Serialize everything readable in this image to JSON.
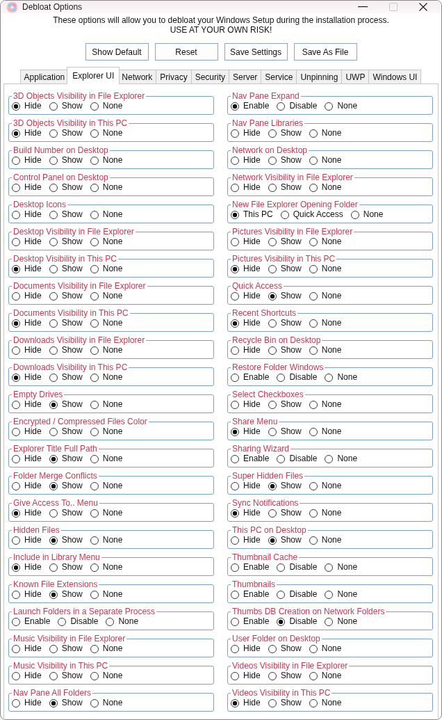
{
  "window": {
    "title": "Debloat Options",
    "maximize_disabled": true
  },
  "intro": "These options will allow you to debloat your Windows Setup during the installation process.",
  "warning": "USE AT YOUR OWN RISK!",
  "buttons": [
    "Show Default",
    "Reset",
    "Save Settings",
    "Save As File"
  ],
  "tabs": [
    {
      "label": "Application",
      "selected": false
    },
    {
      "label": "Explorer UI",
      "selected": true
    },
    {
      "label": "Network",
      "selected": false
    },
    {
      "label": "Privacy",
      "selected": false
    },
    {
      "label": "Security",
      "selected": false
    },
    {
      "label": "Server",
      "selected": false
    },
    {
      "label": "Service",
      "selected": false
    },
    {
      "label": "Unpinning",
      "selected": false
    },
    {
      "label": "UWP",
      "selected": false
    },
    {
      "label": "Windows UI",
      "selected": false
    }
  ],
  "columns": [
    {
      "groups": [
        {
          "title": "3D Objects Visibility in File Explorer",
          "choices": [
            {
              "label": "Hide",
              "selected": true
            },
            {
              "label": "Show",
              "selected": false
            },
            {
              "label": "None",
              "selected": false
            }
          ]
        },
        {
          "title": "3D Objects Visibility in This PC",
          "choices": [
            {
              "label": "Hide",
              "selected": true
            },
            {
              "label": "Show",
              "selected": false
            },
            {
              "label": "None",
              "selected": false
            }
          ]
        },
        {
          "title": "Build Number on Desktop",
          "choices": [
            {
              "label": "Hide",
              "selected": false
            },
            {
              "label": "Show",
              "selected": false
            },
            {
              "label": "None",
              "selected": false
            }
          ]
        },
        {
          "title": "Control Panel on Desktop",
          "choices": [
            {
              "label": "Hide",
              "selected": false
            },
            {
              "label": "Show",
              "selected": false
            },
            {
              "label": "None",
              "selected": false
            }
          ]
        },
        {
          "title": "Desktop Icons",
          "choices": [
            {
              "label": "Hide",
              "selected": false
            },
            {
              "label": "Show",
              "selected": false
            },
            {
              "label": "None",
              "selected": false
            }
          ]
        },
        {
          "title": "Desktop Visibility in File Explorer",
          "choices": [
            {
              "label": "Hide",
              "selected": false
            },
            {
              "label": "Show",
              "selected": false
            },
            {
              "label": "None",
              "selected": false
            }
          ]
        },
        {
          "title": "Desktop Visibility in This PC",
          "choices": [
            {
              "label": "Hide",
              "selected": true
            },
            {
              "label": "Show",
              "selected": false
            },
            {
              "label": "None",
              "selected": false
            }
          ]
        },
        {
          "title": "Documents Visibility in File Explorer",
          "choices": [
            {
              "label": "Hide",
              "selected": false
            },
            {
              "label": "Show",
              "selected": false
            },
            {
              "label": "None",
              "selected": false
            }
          ]
        },
        {
          "title": "Documents Visibility in This PC",
          "choices": [
            {
              "label": "Hide",
              "selected": true
            },
            {
              "label": "Show",
              "selected": false
            },
            {
              "label": "None",
              "selected": false
            }
          ]
        },
        {
          "title": "Downloads Visibility in File Explorer",
          "choices": [
            {
              "label": "Hide",
              "selected": false
            },
            {
              "label": "Show",
              "selected": false
            },
            {
              "label": "None",
              "selected": false
            }
          ]
        },
        {
          "title": "Downloads Visibility in This PC",
          "choices": [
            {
              "label": "Hide",
              "selected": true
            },
            {
              "label": "Show",
              "selected": false
            },
            {
              "label": "None",
              "selected": false
            }
          ]
        },
        {
          "title": "Empty Drives",
          "choices": [
            {
              "label": "Hide",
              "selected": false
            },
            {
              "label": "Show",
              "selected": true
            },
            {
              "label": "None",
              "selected": false
            }
          ]
        },
        {
          "title": "Encrypted / Compressed Files Color",
          "choices": [
            {
              "label": "Hide",
              "selected": false
            },
            {
              "label": "Show",
              "selected": false
            },
            {
              "label": "None",
              "selected": false
            }
          ]
        },
        {
          "title": "Explorer Title Full Path",
          "choices": [
            {
              "label": "Hide",
              "selected": false
            },
            {
              "label": "Show",
              "selected": true
            },
            {
              "label": "None",
              "selected": false
            }
          ]
        },
        {
          "title": "Folder Merge Conflicts",
          "choices": [
            {
              "label": "Hide",
              "selected": false
            },
            {
              "label": "Show",
              "selected": true
            },
            {
              "label": "None",
              "selected": false
            }
          ]
        },
        {
          "title": "Give Access To.. Menu",
          "choices": [
            {
              "label": "Hide",
              "selected": true
            },
            {
              "label": "Show",
              "selected": false
            },
            {
              "label": "None",
              "selected": false
            }
          ]
        },
        {
          "title": "Hidden Files",
          "choices": [
            {
              "label": "Hide",
              "selected": false
            },
            {
              "label": "Show",
              "selected": true
            },
            {
              "label": "None",
              "selected": false
            }
          ]
        },
        {
          "title": "Include in Library Menu",
          "choices": [
            {
              "label": "Hide",
              "selected": true
            },
            {
              "label": "Show",
              "selected": false
            },
            {
              "label": "None",
              "selected": false
            }
          ]
        },
        {
          "title": "Known File Extensions",
          "choices": [
            {
              "label": "Hide",
              "selected": false
            },
            {
              "label": "Show",
              "selected": true
            },
            {
              "label": "None",
              "selected": false
            }
          ]
        },
        {
          "title": "Launch Folders in a Separate Process",
          "choices": [
            {
              "label": "Enable",
              "selected": false
            },
            {
              "label": "Disable",
              "selected": false
            },
            {
              "label": "None",
              "selected": false
            }
          ]
        },
        {
          "title": "Music Visibility in File Explorer",
          "choices": [
            {
              "label": "Hide",
              "selected": false
            },
            {
              "label": "Show",
              "selected": false
            },
            {
              "label": "None",
              "selected": false
            }
          ]
        },
        {
          "title": "Music Visibility in This PC",
          "choices": [
            {
              "label": "Hide",
              "selected": false
            },
            {
              "label": "Show",
              "selected": false
            },
            {
              "label": "None",
              "selected": false
            }
          ]
        },
        {
          "title": "Nav Pane All Folders",
          "choices": [
            {
              "label": "Hide",
              "selected": false
            },
            {
              "label": "Show",
              "selected": true
            },
            {
              "label": "None",
              "selected": false
            }
          ]
        }
      ]
    },
    {
      "groups": [
        {
          "title": "Nav Pane Expand",
          "choices": [
            {
              "label": "Enable",
              "selected": true
            },
            {
              "label": "Disable",
              "selected": false
            },
            {
              "label": "None",
              "selected": false
            }
          ]
        },
        {
          "title": "Nav Pane Libraries",
          "choices": [
            {
              "label": "Hide",
              "selected": false
            },
            {
              "label": "Show",
              "selected": false
            },
            {
              "label": "None",
              "selected": false
            }
          ]
        },
        {
          "title": "Network on Desktop",
          "choices": [
            {
              "label": "Hide",
              "selected": false
            },
            {
              "label": "Show",
              "selected": false
            },
            {
              "label": "None",
              "selected": false
            }
          ]
        },
        {
          "title": "Network Visibility in File Explorer",
          "choices": [
            {
              "label": "Hide",
              "selected": false
            },
            {
              "label": "Show",
              "selected": false
            },
            {
              "label": "None",
              "selected": false
            }
          ]
        },
        {
          "title": "New File Explorer Opening Folder",
          "choices": [
            {
              "label": "This PC",
              "selected": true
            },
            {
              "label": "Quick Access",
              "selected": false
            },
            {
              "label": "None",
              "selected": false
            }
          ]
        },
        {
          "title": "Pictures Visibility in File Explorer",
          "choices": [
            {
              "label": "Hide",
              "selected": false
            },
            {
              "label": "Show",
              "selected": false
            },
            {
              "label": "None",
              "selected": false
            }
          ]
        },
        {
          "title": "Pictures Visibility in This PC",
          "choices": [
            {
              "label": "Hide",
              "selected": true
            },
            {
              "label": "Show",
              "selected": false
            },
            {
              "label": "None",
              "selected": false
            }
          ]
        },
        {
          "title": "Quick Access",
          "choices": [
            {
              "label": "Hide",
              "selected": false
            },
            {
              "label": "Show",
              "selected": true
            },
            {
              "label": "None",
              "selected": false
            }
          ]
        },
        {
          "title": "Recent Shortcuts",
          "choices": [
            {
              "label": "Hide",
              "selected": true
            },
            {
              "label": "Show",
              "selected": false
            },
            {
              "label": "None",
              "selected": false
            }
          ]
        },
        {
          "title": "Recycle Bin on Desktop",
          "choices": [
            {
              "label": "Hide",
              "selected": false
            },
            {
              "label": "Show",
              "selected": false
            },
            {
              "label": "None",
              "selected": false
            }
          ]
        },
        {
          "title": "Restore Folder Windows",
          "choices": [
            {
              "label": "Enable",
              "selected": false
            },
            {
              "label": "Disable",
              "selected": false
            },
            {
              "label": "None",
              "selected": false
            }
          ]
        },
        {
          "title": "Select Checkboxes",
          "choices": [
            {
              "label": "Hide",
              "selected": false
            },
            {
              "label": "Show",
              "selected": false
            },
            {
              "label": "None",
              "selected": false
            }
          ]
        },
        {
          "title": "Share Menu",
          "choices": [
            {
              "label": "Hide",
              "selected": true
            },
            {
              "label": "Show",
              "selected": false
            },
            {
              "label": "None",
              "selected": false
            }
          ]
        },
        {
          "title": "Sharing Wizard",
          "choices": [
            {
              "label": "Enable",
              "selected": false
            },
            {
              "label": "Disable",
              "selected": false
            },
            {
              "label": "None",
              "selected": false
            }
          ]
        },
        {
          "title": "Super Hidden Files",
          "choices": [
            {
              "label": "Hide",
              "selected": false
            },
            {
              "label": "Show",
              "selected": true
            },
            {
              "label": "None",
              "selected": false
            }
          ]
        },
        {
          "title": "Sync Notifications",
          "choices": [
            {
              "label": "Hide",
              "selected": true
            },
            {
              "label": "Show",
              "selected": false
            },
            {
              "label": "None",
              "selected": false
            }
          ]
        },
        {
          "title": "This PC on Desktop",
          "choices": [
            {
              "label": "Hide",
              "selected": false
            },
            {
              "label": "Show",
              "selected": true
            },
            {
              "label": "None",
              "selected": false
            }
          ]
        },
        {
          "title": "Thumbnail Cache",
          "choices": [
            {
              "label": "Enable",
              "selected": false
            },
            {
              "label": "Disable",
              "selected": false
            },
            {
              "label": "None",
              "selected": false
            }
          ]
        },
        {
          "title": "Thumbnails",
          "choices": [
            {
              "label": "Enable",
              "selected": false
            },
            {
              "label": "Disable",
              "selected": false
            },
            {
              "label": "None",
              "selected": false
            }
          ]
        },
        {
          "title": "Thumbs DB Creation on Network Folders",
          "choices": [
            {
              "label": "Enable",
              "selected": false
            },
            {
              "label": "Disable",
              "selected": true
            },
            {
              "label": "None",
              "selected": false
            }
          ]
        },
        {
          "title": "User Folder on Desktop",
          "choices": [
            {
              "label": "Hide",
              "selected": false
            },
            {
              "label": "Show",
              "selected": false
            },
            {
              "label": "None",
              "selected": false
            }
          ]
        },
        {
          "title": "Videos Visibility in File Explorer",
          "choices": [
            {
              "label": "Hide",
              "selected": false
            },
            {
              "label": "Show",
              "selected": false
            },
            {
              "label": "None",
              "selected": false
            }
          ]
        },
        {
          "title": "Videos Visibility in This PC",
          "choices": [
            {
              "label": "Hide",
              "selected": true
            },
            {
              "label": "Show",
              "selected": false
            },
            {
              "label": "None",
              "selected": false
            }
          ]
        }
      ]
    }
  ]
}
